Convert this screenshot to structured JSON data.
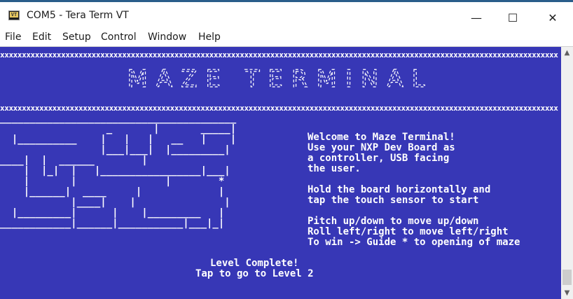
{
  "window": {
    "title": "COM5 - Tera Term VT",
    "icon_label": "VT",
    "minimize_glyph": "—",
    "maximize_glyph": "☐",
    "close_glyph": "✕"
  },
  "menu": {
    "items": [
      "File",
      "Edit",
      "Setup",
      "Control",
      "Window",
      "Help"
    ]
  },
  "terminal": {
    "border_row": "xxxxxxxxxxxxxxxxxxxxxxxxxxxxxxxxxxxxxxxxxxxxxxxxxxxxxxxxxxxxxxxxxxxxxxxxxxxxxxxxxxxxxxxxxxxxxxxxxxxxxxxxxxxxxxxxxxxxxxxxxxxxxxxx",
    "banner_title": "MAZE TERMINAL",
    "maze_rows": [
      "________________________________________",
      "                  _       |       _____|",
      "  |__________    |   |   |   __   |    |",
      "                 |___|___|  |_________|",
      "____|  |  ______        |",
      "    |  |_|  |   |_________________|___|",
      "    |       |               |        *",
      "    |______|  ____     |             |",
      "            |____|    |               |",
      "  |_________|      |    |_________   |",
      "____________|______|___________|___|_|"
    ],
    "welcome_lines": [
      "Welcome to Maze Terminal!",
      "Use your NXP Dev Board as",
      "a controller, USB facing",
      "the user."
    ],
    "instruction_lines": [
      "Hold the board horizontally and",
      "tap the touch sensor to start"
    ],
    "control_lines": [
      "Pitch up/down to move up/down",
      "Roll left/right to move left/right",
      "To win -> Guide * to opening of maze"
    ],
    "status_lines": [
      "Level Complete!",
      "Tap to go to Level 2"
    ]
  },
  "colors": {
    "terminal_bg": "#3737b6",
    "terminal_fg": "#ffffff"
  }
}
